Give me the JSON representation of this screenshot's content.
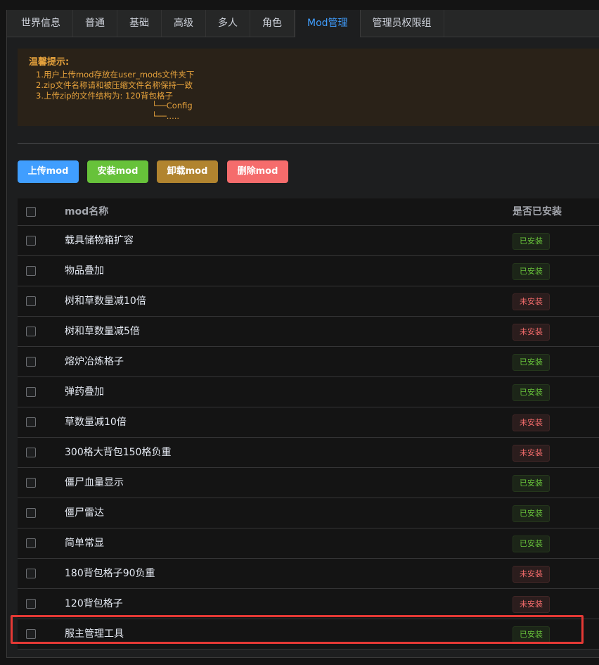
{
  "tabs": [
    "世界信息",
    "普通",
    "基础",
    "高级",
    "多人",
    "角色",
    "Mod管理",
    "管理员权限组"
  ],
  "active_tab_index": 6,
  "tip": {
    "title": "温馨提示:",
    "line1": "1.用户上传mod存放在user_mods文件夹下",
    "line2": "2.zip文件名称请和被压缩文件名称保持一致",
    "line3": "3.上传zip的文件结构为: 120背包格子",
    "tree1": "└──Config",
    "tree2": "└──....."
  },
  "buttons": {
    "upload": "上传mod",
    "install": "安装mod",
    "uninstall": "卸载mod",
    "delete": "删除mod"
  },
  "table": {
    "col_name": "mod名称",
    "col_installed": "是否已安装",
    "installed_label": "已安装",
    "not_installed_label": "未安装",
    "rows": [
      {
        "name": "载具储物箱扩容",
        "status": "已安装"
      },
      {
        "name": "物品叠加",
        "status": "已安装"
      },
      {
        "name": "树和草数量减10倍",
        "status": "未安装"
      },
      {
        "name": "树和草数量减5倍",
        "status": "未安装"
      },
      {
        "name": "熔炉冶炼格子",
        "status": "已安装"
      },
      {
        "name": "弹药叠加",
        "status": "已安装"
      },
      {
        "name": "草数量减10倍",
        "status": "未安装"
      },
      {
        "name": "300格大背包150格负重",
        "status": "未安装"
      },
      {
        "name": "僵尸血量显示",
        "status": "已安装"
      },
      {
        "name": "僵尸雷达",
        "status": "已安装"
      },
      {
        "name": "简单常显",
        "status": "已安装"
      },
      {
        "name": "180背包格子90负重",
        "status": "未安装"
      },
      {
        "name": "120背包格子",
        "status": "未安装"
      },
      {
        "name": "服主管理工具",
        "status": "已安装"
      }
    ]
  },
  "colors": {
    "accent": "#409eff",
    "success": "#67c23a",
    "warning": "#b1842f",
    "danger": "#f56c6c",
    "highlight_border": "#e53935"
  }
}
